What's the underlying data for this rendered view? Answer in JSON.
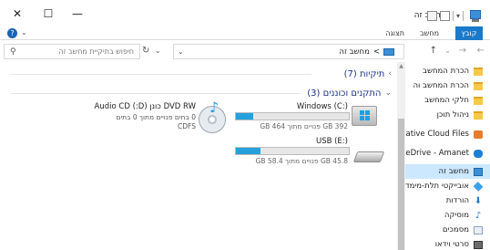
{
  "window": {
    "title": "מחשב זה",
    "minimize_glyph": "—",
    "maximize_glyph": "☐",
    "close_glyph": "✕"
  },
  "ribbon": {
    "tabs": [
      {
        "label": "קובץ"
      },
      {
        "label": "מחשב"
      },
      {
        "label": "תצוגה"
      }
    ],
    "help_glyph": "?",
    "collapse_glyph": "⌄"
  },
  "navigation": {
    "back_glyph": "←",
    "forward_glyph": "→",
    "recent_glyph": "⌄",
    "up_glyph": "↑",
    "address": {
      "path_label": "מחשב זה",
      "separator": ">"
    },
    "refresh_glyph": "↻",
    "search": {
      "placeholder": "חיפוש בתיקיית מחשב זה",
      "icon_glyph": "⚲"
    }
  },
  "sidebar": {
    "items": [
      {
        "label": "הכרת המחשב",
        "icon": "folder-icon"
      },
      {
        "label": "הכרת המחשב וה",
        "icon": "folder-icon"
      },
      {
        "label": "חלקי המחשב",
        "icon": "folder-icon"
      },
      {
        "label": "ניהול תוכן",
        "icon": "folder-icon"
      },
      {
        "label": "Creative Cloud Files",
        "icon": "creative-cloud-icon"
      },
      {
        "label": "OneDrive - Amanet",
        "icon": "onedrive-icon"
      },
      {
        "label": "מחשב זה",
        "icon": "computer-icon",
        "selected": true
      },
      {
        "label": "אובייקטי תלת-מימד",
        "icon": "cube-icon"
      },
      {
        "label": "הורדות",
        "icon": "download-icon"
      },
      {
        "label": "מוסיקה",
        "icon": "music-icon"
      },
      {
        "label": "מסמכים",
        "icon": "documents-icon"
      },
      {
        "label": "סרטי וידאו",
        "icon": "video-icon"
      }
    ]
  },
  "main": {
    "groups": [
      {
        "label": "תיקיות (7)",
        "expanded": false
      },
      {
        "label": "התקנים וכוננים (3)",
        "expanded": true
      }
    ],
    "drives": [
      {
        "name": "Windows (C:)",
        "free": "392 GB פנויים מתוך 464 GB",
        "used_fraction": 0.155
      },
      {
        "name": "USB (E:)",
        "free": "45.8 GB פנויים מתוך 58.4 GB",
        "used_fraction": 0.216
      },
      {
        "name": "DVD RW כונן (D:) Audio CD",
        "line2": "0 בתים פנויים מתוך 0 בתים",
        "line3": "CDFS"
      }
    ]
  }
}
